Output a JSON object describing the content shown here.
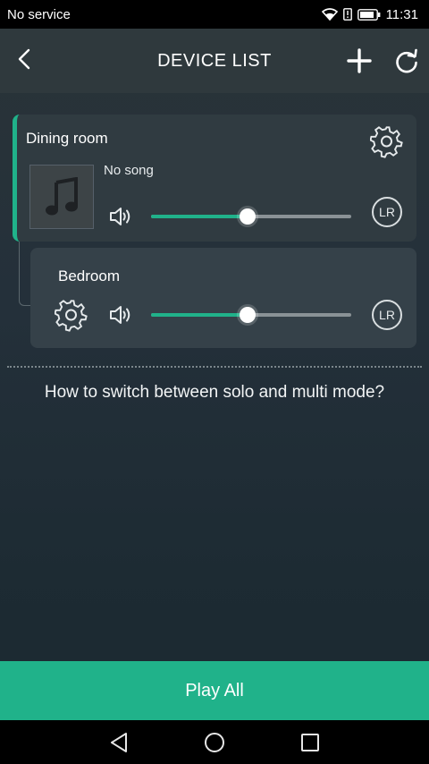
{
  "status_bar": {
    "carrier": "No service",
    "time": "11:31"
  },
  "header": {
    "title": "DEVICE LIST"
  },
  "devices": [
    {
      "name": "Dining room",
      "song": "No song",
      "volume_fraction": 0.48,
      "channel_label": "LR"
    },
    {
      "name": "Bedroom",
      "volume_fraction": 0.48,
      "channel_label": "LR"
    }
  ],
  "help": {
    "text": "How to switch between solo and multi mode?"
  },
  "footer": {
    "play_all_label": "Play All"
  },
  "colors": {
    "accent": "#20b28a",
    "card": "#303b41",
    "header": "#2f393d"
  },
  "icons": [
    "wifi-icon",
    "battery-icon",
    "back-arrow-icon",
    "plus-icon",
    "refresh-icon",
    "gear-icon",
    "music-note-icon",
    "speaker-volume-icon",
    "nav-back-icon",
    "nav-home-icon",
    "nav-recents-icon"
  ]
}
